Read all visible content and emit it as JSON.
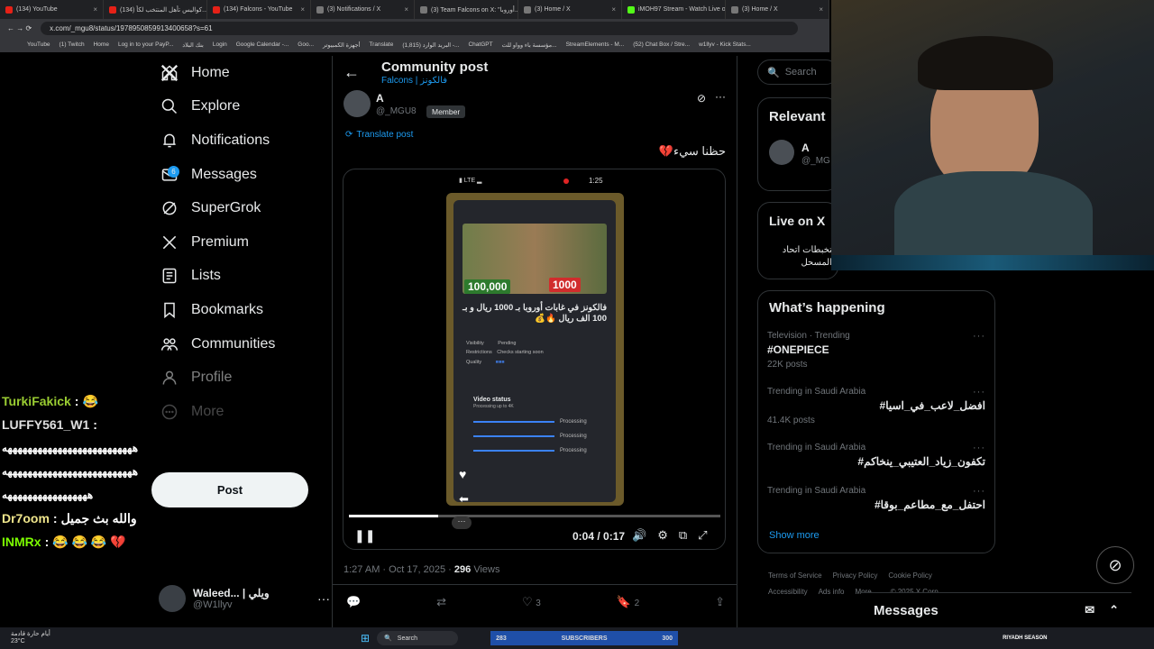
{
  "browser": {
    "tabs": [
      "(134) YouTube",
      "(134) كواليس تأهل المنتخب لكأ...",
      "(134) Falcons - YouTube",
      "(3) Notifications / X",
      "(3) Team Falcons on X: \"أوروبا...",
      "(3) Home / X",
      "iMOH97 Stream - Watch Live o...",
      "(3) Home / X"
    ],
    "url": "x.com/_mgu8/status/1978950859913400658?s=61",
    "bookmarks": [
      "YouTube",
      "(1) Twitch",
      "Home",
      "Log in to your PayP...",
      "بنك البلاد",
      "Login",
      "Google Calendar -...",
      "Goo...",
      "أجهزة الكمبيوتر",
      "Translate",
      "(1,815) البريد الوارد -...",
      "ChatGPT",
      "مؤسسة باء وواو للت...",
      "StreamElements - M...",
      "(52) Chat Box / Stre...",
      "w1llyv - Kick Stats..."
    ]
  },
  "nav": {
    "items": [
      {
        "label": "Home",
        "icon": "home-icon"
      },
      {
        "label": "Explore",
        "icon": "search-icon"
      },
      {
        "label": "Notifications",
        "icon": "bell-icon"
      },
      {
        "label": "Messages",
        "icon": "mail-icon"
      },
      {
        "label": "SuperGrok",
        "icon": "grok-icon"
      },
      {
        "label": "Premium",
        "icon": "x-icon"
      },
      {
        "label": "Lists",
        "icon": "list-icon"
      },
      {
        "label": "Bookmarks",
        "icon": "bookmark-icon"
      },
      {
        "label": "Communities",
        "icon": "people-icon"
      },
      {
        "label": "Profile",
        "icon": "person-icon"
      },
      {
        "label": "More",
        "icon": "more-icon"
      }
    ],
    "notif_badge": "6",
    "post_label": "Post",
    "account": {
      "name": "Waleed... | ويلي",
      "handle": "@W1llyv"
    }
  },
  "chat": [
    {
      "user": "TurkiFakick",
      "msg": "😂",
      "color": "#9acd32"
    },
    {
      "user": "LUFFY561_W1",
      "msg": "",
      "color": "#e0e0e0"
    },
    {
      "user": "",
      "msg": "ههههههههههههههههههههههههههه",
      "color": "#fff"
    },
    {
      "user": "",
      "msg": "ههههههههههههههههههههههههههه",
      "color": "#fff"
    },
    {
      "user": "",
      "msg": "هههههههههههههههههه",
      "color": "#fff"
    },
    {
      "user": "Dr7oom",
      "msg": "والله بث جميل",
      "color": "#f0e68c"
    },
    {
      "user": "INMRx",
      "msg": "😂 😂 😂 💔",
      "color": "#7cfc00"
    }
  ],
  "post": {
    "header": "Community post",
    "community": "Falcons | فالكونز",
    "author_name": "A",
    "author_handle": "@_MGU8",
    "member_badge": "Member",
    "translate": "Translate post",
    "text": "حظنا سيء💔",
    "video": {
      "time": "0:04 / 0:17",
      "status_time": "1:25",
      "headline": "فالكونز في غابات أوروبا بـ 1000 ريال و بـ 100 الف ريال 🔥💰",
      "price_a": "100,000",
      "price_b": "1000",
      "progress": 0.24,
      "vis_label": "Visibility",
      "vis_value": "Pending",
      "restr_label": "Restrictions",
      "restr_value": "Checks starting soon",
      "quality_label": "Quality",
      "status_title": "Video status",
      "status_sub": "Processing up to 4K",
      "processing": "Processing"
    },
    "meta_time": "1:27 AM · Oct 17, 2025 · ",
    "views_count": "296",
    "views_label": " Views",
    "likes": "3",
    "bookmarks": "2"
  },
  "sidebar": {
    "search_placeholder": "Search",
    "relevant_title": "Relevant",
    "relevant_name": "A",
    "relevant_handle": "@_MG",
    "live_title": "Live on X",
    "live_text": "تخبطات اتحاد المسحل",
    "happening_title": "What’s happening",
    "trends": [
      {
        "context": "Television · Trending",
        "name": "#ONEPIECE",
        "posts": "22K posts"
      },
      {
        "context": "Trending in Saudi Arabia",
        "name": "#افضل_لاعب_في_اسيا",
        "posts": "41.4K posts"
      },
      {
        "context": "Trending in Saudi Arabia",
        "name": "#تكفون_زياد_العتيبي_ينخاكم",
        "posts": ""
      },
      {
        "context": "Trending in Saudi Arabia",
        "name": "#احتفل_مع_مطاعم_بوقا",
        "posts": ""
      }
    ],
    "show_more": "Show more",
    "footer": [
      "Terms of Service",
      "Privacy Policy",
      "Cookie Policy",
      "Accessibility",
      "Ads info",
      "More ...",
      "© 2025 X Corp."
    ],
    "messages": "Messages"
  },
  "taskbar": {
    "weather": "أيام حارة قادمة",
    "temp": "23°C",
    "search": "Search",
    "subs_label": "SUBSCRIBERS",
    "subs_current": "283",
    "subs_goal": "300",
    "season": "RIYADH SEASON"
  }
}
